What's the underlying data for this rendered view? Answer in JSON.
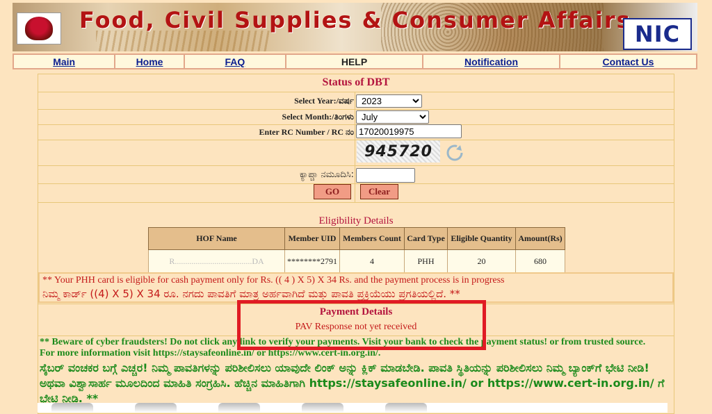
{
  "header": {
    "title": "Food, Civil Supplies & Consumer Affairs",
    "nic_logo": "NIC"
  },
  "nav": {
    "items": [
      "Main",
      "Home",
      "FAQ",
      "HELP",
      "Notification",
      "Contact Us"
    ]
  },
  "form": {
    "heading": "Status of DBT",
    "year_label": "Select Year:/ವರ್ಷ",
    "year_value": "2023",
    "month_label": "Select Month:/ತಿಂಗಳು",
    "month_value": "July",
    "rc_label": "Enter RC Number  / RC ನಂ",
    "rc_value": "17020019975",
    "captcha_text": "945720",
    "captcha_label": "ಕ್ಯಾಪ್ಚಾ ನಮೂದಿಸಿ:",
    "captcha_input": "",
    "go_label": "GO",
    "clear_label": "Clear"
  },
  "eligibility": {
    "title": "Eligibility Details",
    "columns": [
      "HOF Name",
      "Member UID",
      "Members Count",
      "Card Type",
      "Eligible Quantity",
      "Amount(Rs)"
    ],
    "row": [
      "R.....................................DA",
      "********2791",
      "4",
      "PHH",
      "20",
      "680"
    ]
  },
  "notice": {
    "en": "** Your PHH card is eligible for cash payment only for Rs. (( 4 ) X 5) X 34 Rs. and the payment process is in progress",
    "kn": "ನಿಮ್ಮ ಕಾರ್ಡ್ ((4) X 5) X 34 ರೂ. ನಗದು ಪಾವತಿಗೆ ಮಾತ್ರ ಅರ್ಹವಾಗಿದೆ ಮತ್ತು ಪಾವತಿ ಪ್ರಕ್ರಿಯೆಯು ಪ್ರಗತಿಯಲ್ಲಿದೆ. **"
  },
  "payment": {
    "title": "Payment Details",
    "message": "PAV Response not yet received"
  },
  "warning": {
    "en": "** Beware of cyber fraudsters! Do not click any link to verify your payments. Visit your bank to check the payment status! or from trusted source. For more information visit https://staysafeonline.in/ or https://www.cert-in.org.in/.",
    "kn": "ಸೈಬರ್ ವಂಚಕರ ಬಗ್ಗೆ ಎಚ್ಚರ! ನಿಮ್ಮ ಪಾವತಿಗಳನ್ನು ಪರಿಶೀಲಿಸಲು ಯಾವುದೇ ಲಿಂಕ್ ಅನ್ನು ಕ್ಲಿಕ್ ಮಾಡಬೇಡಿ. ಪಾವತಿ ಸ್ಥಿತಿಯನ್ನು ಪರಿಶೀಲಿಸಲು ನಿಮ್ಮ ಬ್ಯಾಂಕ್‌ಗೆ ಭೇಟಿ ನೀಡಿ! ಅಥವಾ ವಿಶ್ವಾಸಾರ್ಹ ಮೂಲದಿಂದ ಮಾಹಿತಿ ಸಂಗ್ರಹಿಸಿ. ಹೆಚ್ಚಿನ ಮಾಹಿತಿಗಾಗಿ https://staysafeonline.in/ or https://www.cert-in.org.in/ ಗೆ ಭೇಟಿ ನೀಡಿ. **"
  },
  "colors": {
    "accent": "#b3133d",
    "alert": "#c41a1a",
    "warning_text": "#1b8a1b",
    "highlight_box": "#e01b24"
  },
  "icons": {
    "emblem": "karnataka-emblem-icon",
    "refresh": "refresh-icon"
  }
}
